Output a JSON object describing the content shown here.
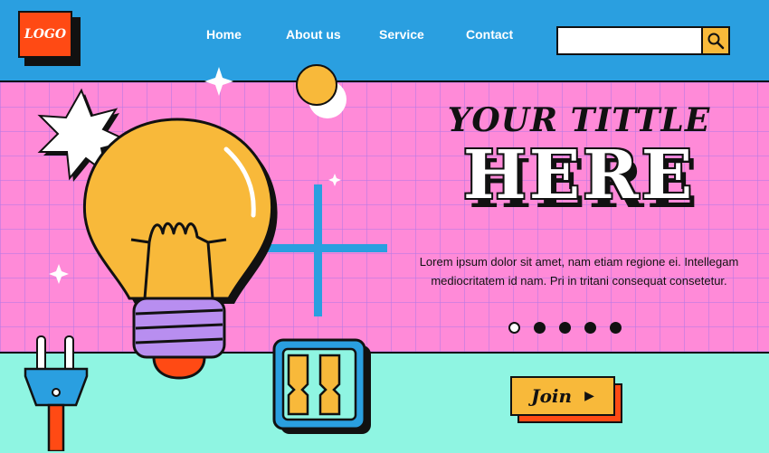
{
  "header": {
    "logo": "LOGO",
    "nav": [
      {
        "label": "Home"
      },
      {
        "label": "About us"
      },
      {
        "label": "Service"
      },
      {
        "label": "Contact"
      }
    ],
    "search": {
      "value": "",
      "placeholder": ""
    },
    "search_icon": "magnifier-icon"
  },
  "hero": {
    "title_line1": "YOUR TITTLE",
    "title_line2": "HERE",
    "description": "Lorem ipsum dolor sit amet, nam etiam regione ei. Intellegam mediocritatem id nam. Pri in tritani consequat consetetur.",
    "carousel": {
      "count": 5,
      "active_index": 0
    },
    "join_label": "Join",
    "join_icon": "triangle-right-icon"
  },
  "colors": {
    "header_bg": "#2a9fe0",
    "hero_bg": "#ff8ad8",
    "bottom_bg": "#8ff5e2",
    "accent_orange": "#ff4a14",
    "accent_yellow": "#f8b93a",
    "accent_purple": "#b88ef0"
  },
  "illustrations": [
    "lightbulb-icon",
    "star-burst-icon",
    "sun-icon",
    "plug-icon",
    "switch-icon",
    "sparkle-icon",
    "cross-icon"
  ]
}
